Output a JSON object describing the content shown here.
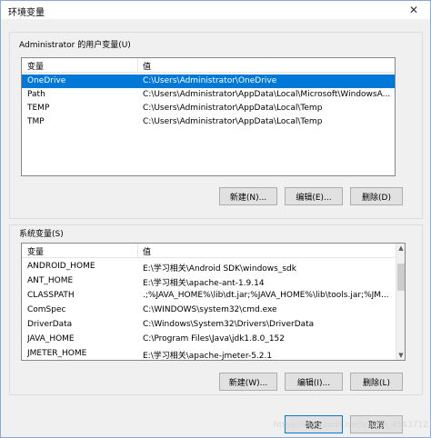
{
  "window": {
    "title": "环境变量",
    "close_glyph": "✕"
  },
  "user_vars": {
    "label": "Administrator 的用户变量(U)",
    "header_var": "变量",
    "header_val": "值",
    "rows": [
      {
        "name": "OneDrive",
        "value": "C:\\Users\\Administrator\\OneDrive"
      },
      {
        "name": "Path",
        "value": "C:\\Users\\Administrator\\AppData\\Local\\Microsoft\\WindowsA..."
      },
      {
        "name": "TEMP",
        "value": "C:\\Users\\Administrator\\AppData\\Local\\Temp"
      },
      {
        "name": "TMP",
        "value": "C:\\Users\\Administrator\\AppData\\Local\\Temp"
      }
    ],
    "selected_index": 0,
    "buttons": {
      "new": "新建(N)...",
      "edit": "编辑(E)...",
      "delete": "删除(D)"
    }
  },
  "system_vars": {
    "label": "系统变量(S)",
    "header_var": "变量",
    "header_val": "值",
    "rows": [
      {
        "name": "ANDROID_HOME",
        "value": "E:\\学习相关\\Android SDK\\windows_sdk"
      },
      {
        "name": "ANT_HOME",
        "value": "E:\\学习相关\\apache-ant-1.9.14"
      },
      {
        "name": "CLASSPATH",
        "value": ".;%JAVA_HOME%\\lib\\dt.jar;%JAVA_HOME%\\lib\\tools.jar;%JM..."
      },
      {
        "name": "ComSpec",
        "value": "C:\\WINDOWS\\system32\\cmd.exe"
      },
      {
        "name": "DriverData",
        "value": "C:\\Windows\\System32\\Drivers\\DriverData"
      },
      {
        "name": "JAVA_HOME",
        "value": "C:\\Program Files\\Java\\jdk1.8.0_152"
      },
      {
        "name": "JMETER_HOME",
        "value": "E:\\学习相关\\apache-jmeter-5.2.1"
      }
    ],
    "buttons": {
      "new": "新建(W)...",
      "edit": "编辑(I)...",
      "delete": "删除(L)"
    }
  },
  "footer": {
    "ok": "确定",
    "cancel": "取消"
  },
  "watermark": "https://blog.csdn.net/weixin_45437123"
}
